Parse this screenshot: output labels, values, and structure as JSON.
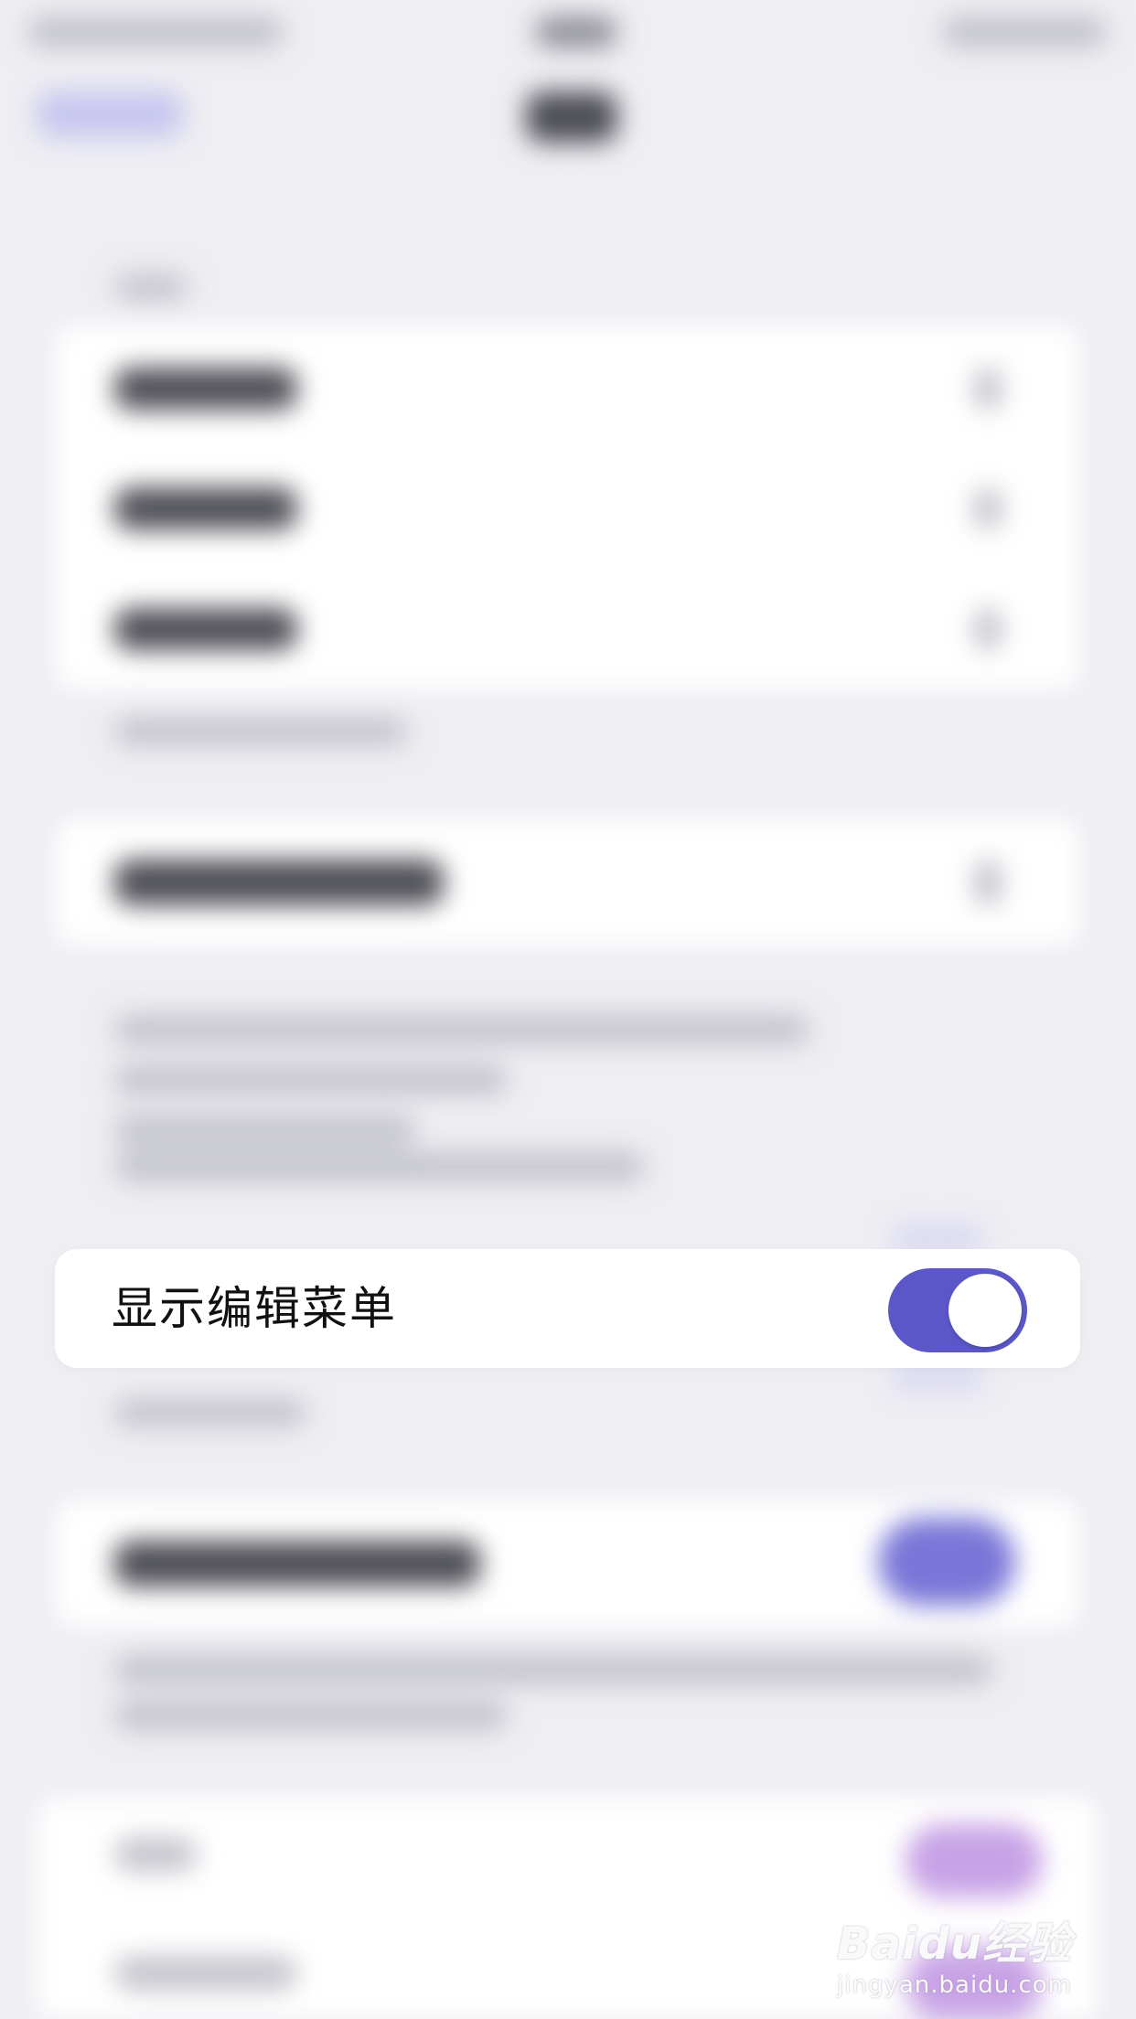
{
  "background_color": "#eeeef3",
  "accent_color": "#5b57c9",
  "focused_setting": {
    "label": "显示编辑菜单",
    "toggle_on": true
  },
  "watermark": {
    "logo_text": "Baidu经验",
    "url": "jingyan.baidu.com"
  }
}
